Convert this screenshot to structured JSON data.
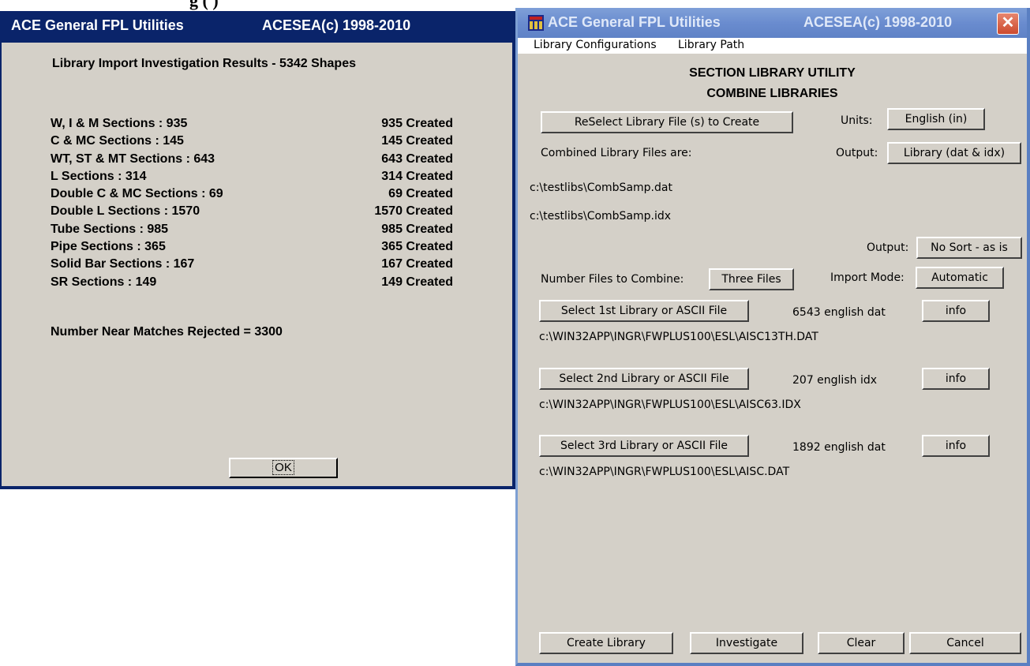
{
  "partial_heading": "g       (       )",
  "results_window": {
    "title": "ACE General FPL Utilities",
    "copyright": "ACESEA(c) 1998-2010",
    "heading": "Library Import Investigation Results - 5342 Shapes",
    "rows": [
      {
        "label": "W, I & M Sections : 935",
        "value": "935 Created"
      },
      {
        "label": "C & MC Sections : 145",
        "value": "145 Created"
      },
      {
        "label": "WT, ST & MT Sections : 643",
        "value": "643 Created"
      },
      {
        "label": "L Sections  : 314",
        "value": "314 Created"
      },
      {
        "label": "Double C & MC Sections : 69",
        "value": "69 Created"
      },
      {
        "label": "Double L Sections : 1570",
        "value": "1570 Created"
      },
      {
        "label": "Tube Sections : 985",
        "value": "985 Created"
      },
      {
        "label": "Pipe Sections : 365",
        "value": "365 Created"
      },
      {
        "label": "Solid Bar Sections : 167",
        "value": "167 Created"
      },
      {
        "label": "SR Sections : 149",
        "value": "149 Created"
      }
    ],
    "rejected": "Number Near Matches Rejected = 3300",
    "ok_label": "OK"
  },
  "utility_window": {
    "title": "ACE General FPL Utilities",
    "copyright": "ACESEA(c) 1998-2010",
    "close_glyph": "✕",
    "menu": [
      "Library Configurations",
      "Library Path"
    ],
    "section_title": "SECTION LIBRARY UTILITY",
    "section_subtitle": "COMBINE LIBRARIES",
    "reselect_label": "ReSelect Library File (s) to Create",
    "units_label": "Units:",
    "units_value": "English (in)",
    "combined_label": "Combined Library Files are:",
    "output_label": "Output:",
    "output_value": "Library (dat & idx)",
    "combined_files": [
      "c:\\testlibs\\CombSamp.dat",
      "c:\\testlibs\\CombSamp.idx"
    ],
    "sort_label": "Output:",
    "sort_value": "No Sort - as is",
    "num_files_label": "Number Files to Combine:",
    "num_files_value": "Three Files",
    "import_mode_label": "Import Mode:",
    "import_mode_value": "Automatic",
    "files": [
      {
        "button": "Select 1st Library or ASCII File",
        "info_text": "6543 english dat",
        "info_button": "info",
        "path": "c:\\WIN32APP\\INGR\\FWPLUS100\\ESL\\AISC13TH.DAT"
      },
      {
        "button": "Select 2nd Library or ASCII File",
        "info_text": "207 english idx",
        "info_button": "info",
        "path": "c:\\WIN32APP\\INGR\\FWPLUS100\\ESL\\AISC63.IDX"
      },
      {
        "button": "Select 3rd Library or ASCII File",
        "info_text": "1892 english dat",
        "info_button": "info",
        "path": "c:\\WIN32APP\\INGR\\FWPLUS100\\ESL\\AISC.DAT"
      }
    ],
    "bottom_buttons": {
      "create": "Create Library",
      "investigate": "Investigate",
      "clear": "Clear",
      "cancel": "Cancel"
    }
  }
}
